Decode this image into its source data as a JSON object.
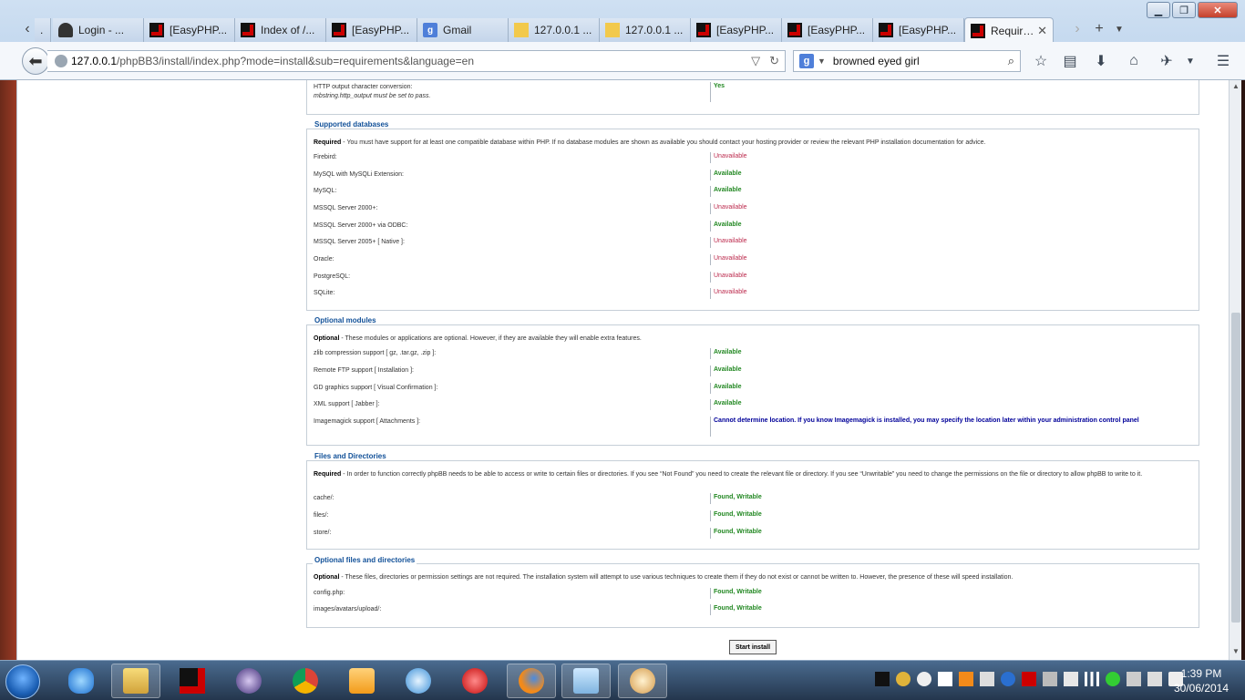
{
  "window": {
    "minimize": "▁",
    "maximize": "❐",
    "close": "✕"
  },
  "tabs": [
    {
      "label": ".",
      "icon": "black"
    },
    {
      "label": "Login - ...",
      "icon": "login"
    },
    {
      "label": "[EasyPHP...",
      "icon": "black"
    },
    {
      "label": "Index of /...",
      "icon": "black"
    },
    {
      "label": "[EasyPHP...",
      "icon": "black"
    },
    {
      "label": "Gmail",
      "icon": "google"
    },
    {
      "label": "127.0.0.1 ...",
      "icon": "pma"
    },
    {
      "label": "127.0.0.1 ...",
      "icon": "pma"
    },
    {
      "label": "[EasyPHP...",
      "icon": "black"
    },
    {
      "label": "[EasyPHP...",
      "icon": "black"
    },
    {
      "label": "[EasyPHP...",
      "icon": "black"
    },
    {
      "label": "Requirem...",
      "icon": "black",
      "active": true
    }
  ],
  "address": {
    "host": "127.0.0.1",
    "path": "/phpBB3/install/index.php?mode=install&sub=requirements&language=en"
  },
  "search": {
    "engine_glyph": "g",
    "value": "browned eyed girl"
  },
  "page": {
    "http_output": {
      "label": "HTTP output character conversion:",
      "sublabel": "mbstring.http_output must be set to pass.",
      "value": "Yes"
    },
    "databases": {
      "legend": "Supported databases",
      "note_strong": "Required",
      "note": " - You must have support for at least one compatible database within PHP. If no database modules are shown as available you should contact your hosting provider or review the relevant PHP installation documentation for advice.",
      "rows": [
        {
          "label": "Firebird:",
          "value": "Unavailable",
          "status": "un"
        },
        {
          "label": "MySQL with MySQLi Extension:",
          "value": "Available",
          "status": "av"
        },
        {
          "label": "MySQL:",
          "value": "Available",
          "status": "av"
        },
        {
          "label": "MSSQL Server 2000+:",
          "value": "Unavailable",
          "status": "un"
        },
        {
          "label": "MSSQL Server 2000+ via ODBC:",
          "value": "Available",
          "status": "av"
        },
        {
          "label": "MSSQL Server 2005+ [ Native ]:",
          "value": "Unavailable",
          "status": "un"
        },
        {
          "label": "Oracle:",
          "value": "Unavailable",
          "status": "un"
        },
        {
          "label": "PostgreSQL:",
          "value": "Unavailable",
          "status": "un"
        },
        {
          "label": "SQLite:",
          "value": "Unavailable",
          "status": "un"
        }
      ]
    },
    "optional_modules": {
      "legend": "Optional modules",
      "note_strong": "Optional",
      "note": " - These modules or applications are optional. However, if they are available they will enable extra features.",
      "rows": [
        {
          "label": "zlib compression support [ gz, .tar.gz, .zip ]:",
          "value": "Available",
          "status": "av"
        },
        {
          "label": "Remote FTP support [ Installation ]:",
          "value": "Available",
          "status": "av"
        },
        {
          "label": "GD graphics support [ Visual Confirmation ]:",
          "value": "Available",
          "status": "av"
        },
        {
          "label": "XML support [ Jabber ]:",
          "value": "Available",
          "status": "av"
        },
        {
          "label": "Imagemagick support [ Attachments ]:",
          "value": "Cannot determine location. If you know Imagemagick is installed, you may specify the location later within your administration control panel",
          "status": "bl"
        }
      ]
    },
    "files": {
      "legend": "Files and Directories",
      "note_strong": "Required",
      "note": " - In order to function correctly phpBB needs to be able to access or write to certain files or directories. If you see “Not Found” you need to create the relevant file or directory. If you see “Unwritable” you need to change the permissions on the file or directory to allow phpBB to write to it.",
      "rows": [
        {
          "label": "cache/:",
          "value": "Found, Writable",
          "status": "av"
        },
        {
          "label": "files/:",
          "value": "Found, Writable",
          "status": "av"
        },
        {
          "label": "store/:",
          "value": "Found, Writable",
          "status": "av"
        }
      ]
    },
    "optional_files": {
      "legend": "Optional files and directories",
      "note_strong": "Optional",
      "note": " - These files, directories or permission settings are not required. The installation system will attempt to use various techniques to create them if they do not exist or cannot be written to. However, the presence of these will speed installation.",
      "rows": [
        {
          "label": "config.php:",
          "value": "Found, Writable",
          "status": "av"
        },
        {
          "label": "images/avatars/upload/:",
          "value": "Found, Writable",
          "status": "av"
        }
      ]
    },
    "start_install": "Start install"
  },
  "taskbar": {
    "time": "1:39 PM",
    "date": "30/06/2014",
    "apps": [
      "internet-explorer",
      "file-explorer",
      "easyphp",
      "eclipse",
      "chrome",
      "media-player",
      "safari",
      "opera",
      "firefox",
      "notepad",
      "paint"
    ]
  },
  "colors": {
    "available": "#228822",
    "unavailable": "#bc2a4d",
    "legend": "#115098",
    "notice": "#000099"
  }
}
